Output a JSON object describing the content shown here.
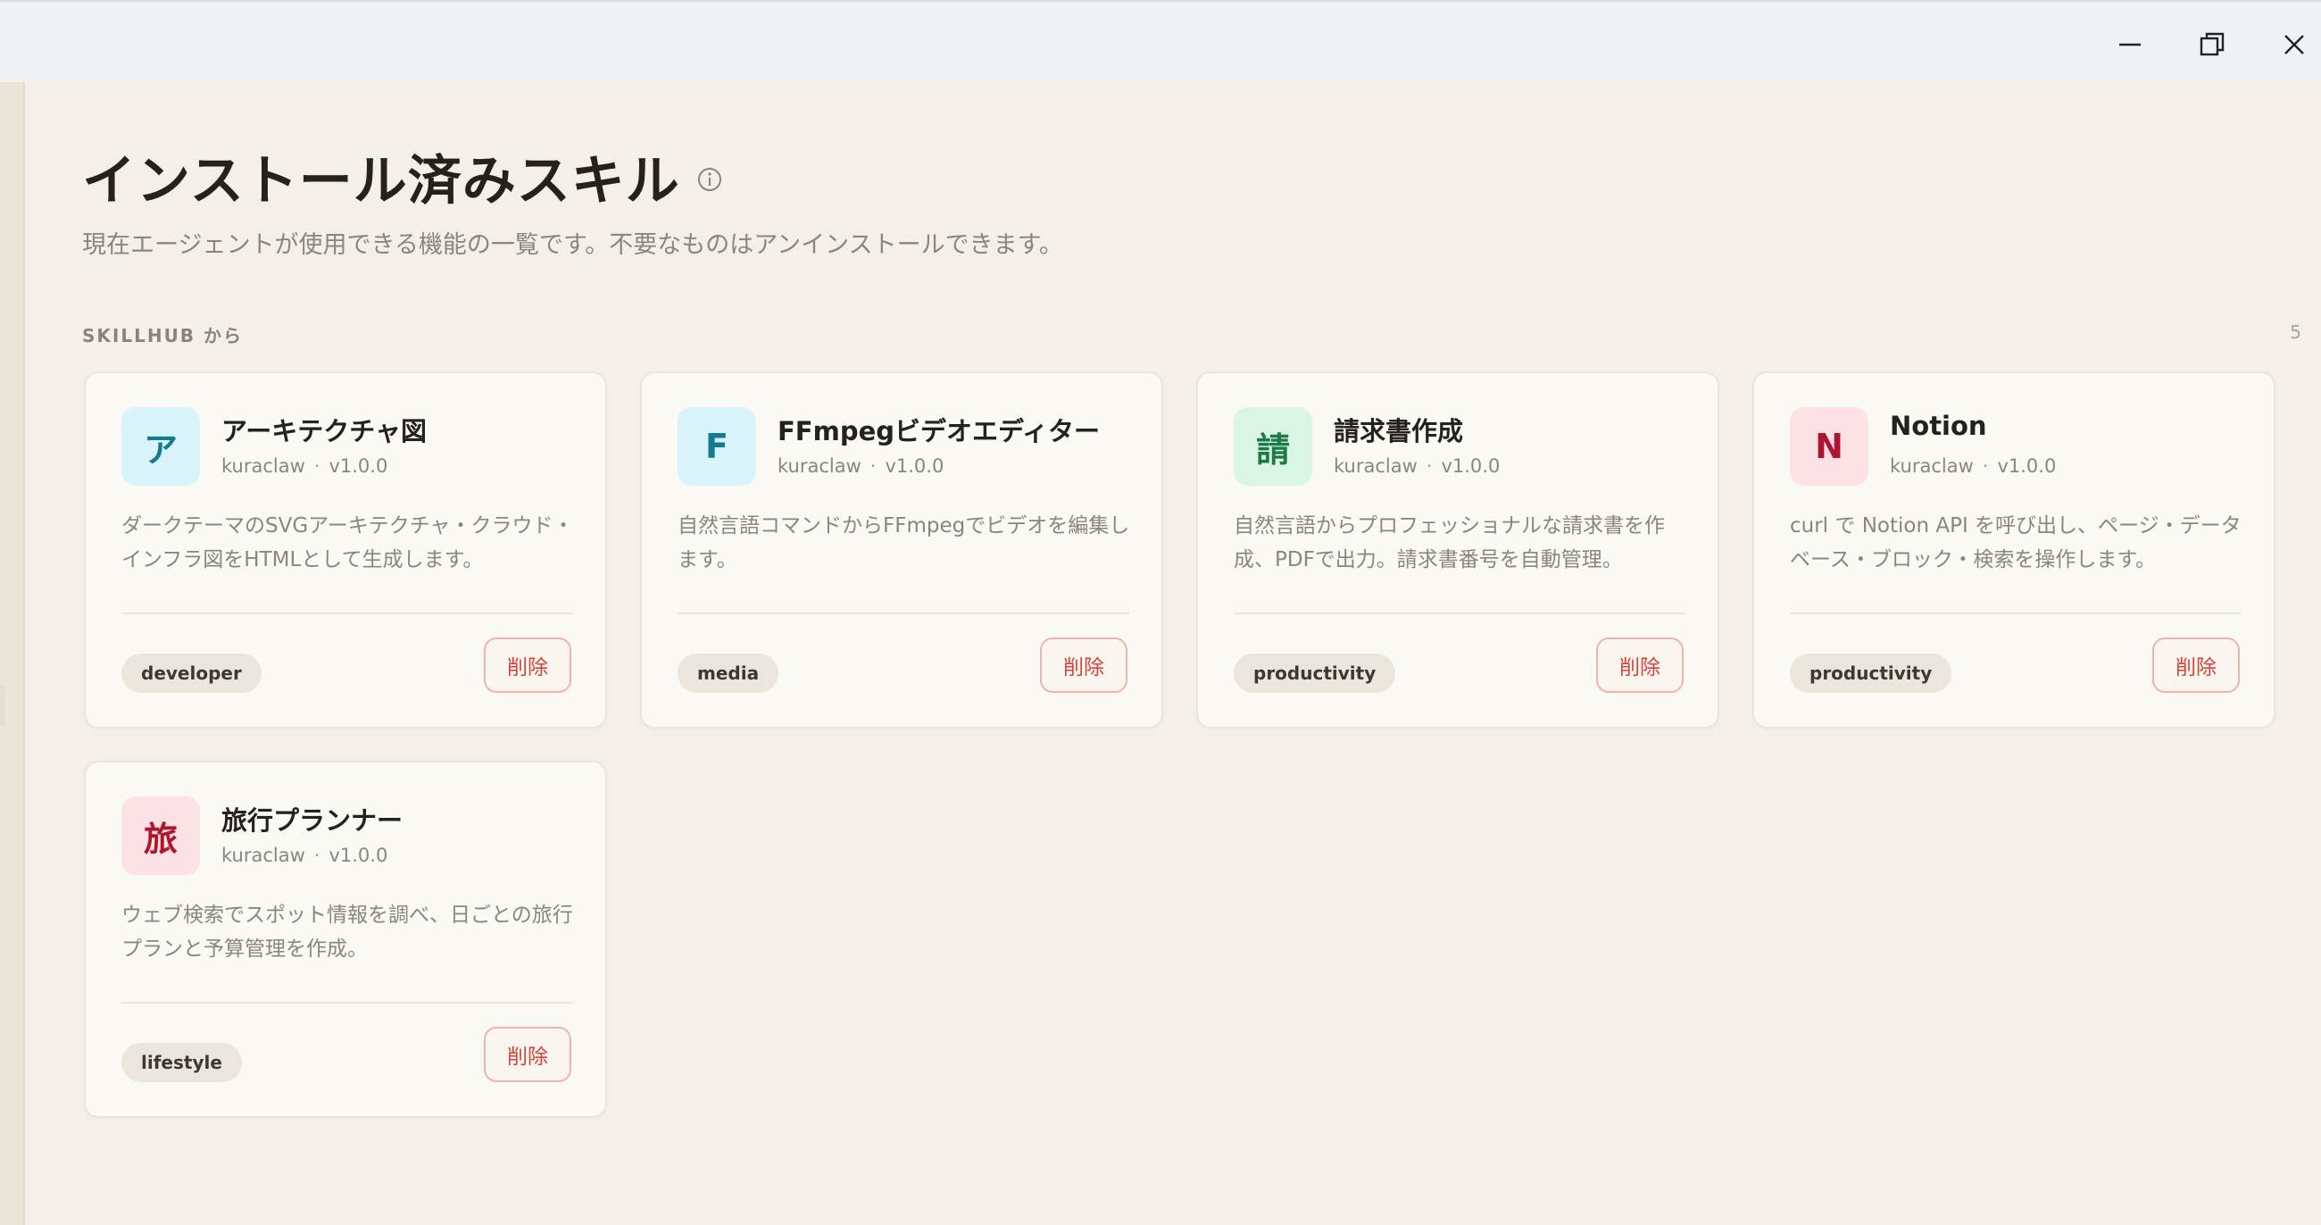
{
  "page": {
    "title": "インストール済みスキル",
    "subtitle": "現在エージェントが使用できる機能の一覧です。不要なものはアンインストールできます。",
    "section_label": "SKILLHUB から",
    "section_count": "5"
  },
  "delete_label": "削除",
  "skills": [
    {
      "icon_char": "ア",
      "icon_bg": "#d8f4fa",
      "icon_fg": "#137a92",
      "name": "アーキテクチャ図",
      "author": "kuraclaw",
      "version": "v1.0.0",
      "description": "ダークテーマのSVGアーキテクチャ・クラウド・インフラ図をHTMLとして生成します。",
      "tag": "developer"
    },
    {
      "icon_char": "F",
      "icon_bg": "#d8f4fa",
      "icon_fg": "#137a92",
      "name": "FFmpegビデオエディター",
      "author": "kuraclaw",
      "version": "v1.0.0",
      "description": "自然言語コマンドからFFmpegでビデオを編集します。",
      "tag": "media"
    },
    {
      "icon_char": "請",
      "icon_bg": "#d9f5e4",
      "icon_fg": "#1b7a47",
      "name": "請求書作成",
      "author": "kuraclaw",
      "version": "v1.0.0",
      "description": "自然言語からプロフェッショナルな請求書を作成、PDFで出力。請求書番号を自動管理。",
      "tag": "productivity"
    },
    {
      "icon_char": "N",
      "icon_bg": "#fde2e5",
      "icon_fg": "#b0142e",
      "name": "Notion",
      "author": "kuraclaw",
      "version": "v1.0.0",
      "description": "curl で Notion API を呼び出し、ページ・データベース・ブロック・検索を操作します。",
      "tag": "productivity"
    },
    {
      "icon_char": "旅",
      "icon_bg": "#fde2e5",
      "icon_fg": "#b0142e",
      "name": "旅行プランナー",
      "author": "kuraclaw",
      "version": "v1.0.0",
      "description": "ウェブ検索でスポット情報を調べ、日ごとの旅行プランと予算管理を作成。",
      "tag": "lifestyle"
    }
  ]
}
